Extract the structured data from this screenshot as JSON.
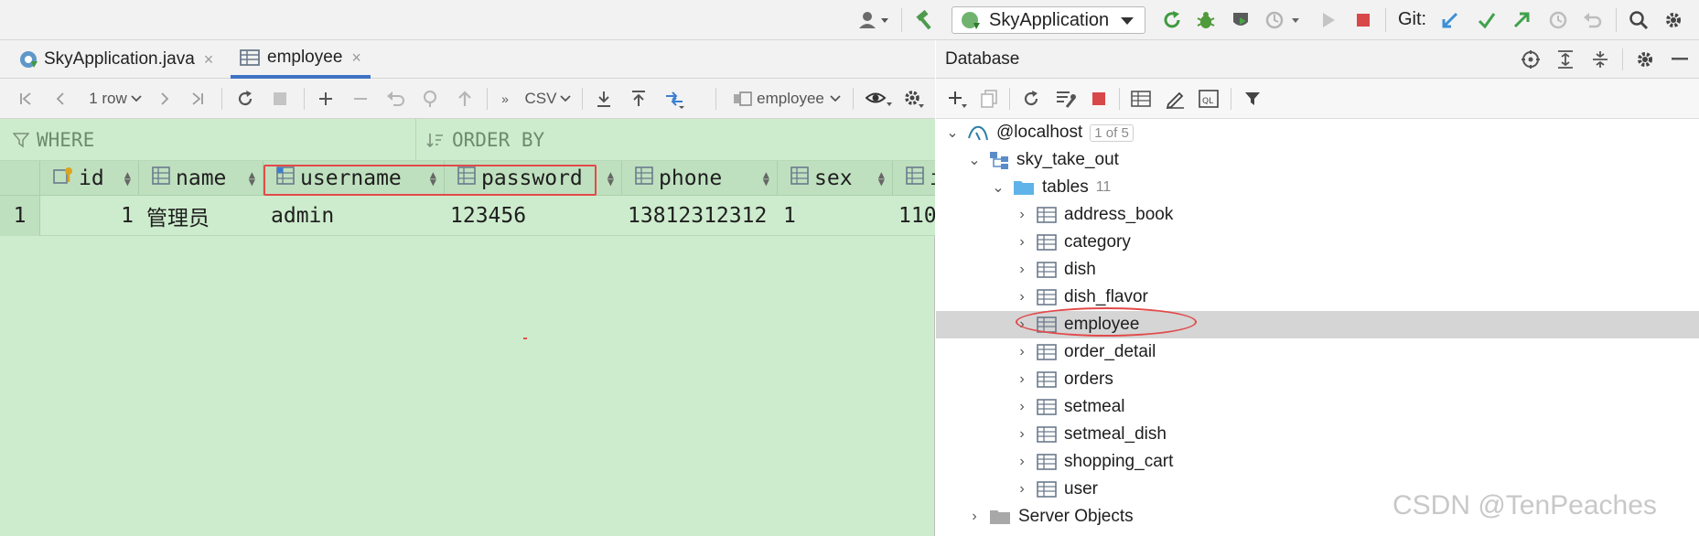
{
  "topbar": {
    "run_config_label": "SkyApplication",
    "git_label": "Git:",
    "icons": [
      "user-icon",
      "hammer-icon",
      "run-icon",
      "debug-icon",
      "coverage-icon",
      "profile-icon",
      "stop-icon",
      "git-update-icon",
      "git-commit-icon",
      "git-push-icon",
      "git-history-icon",
      "git-rollback-icon",
      "search-icon",
      "settings-icon"
    ]
  },
  "editor": {
    "tabs": [
      {
        "label": "SkyApplication.java",
        "active": false
      },
      {
        "label": "employee",
        "active": true
      }
    ],
    "toolbar": {
      "row_count": "1 row",
      "export_format": "CSV",
      "table_selector": "employee"
    },
    "filter": {
      "where_label": "WHERE",
      "order_by_label": "ORDER BY"
    },
    "columns": [
      "id",
      "name",
      "username",
      "password",
      "phone",
      "sex",
      "i"
    ],
    "rows": [
      {
        "row_number": "1",
        "id": "1",
        "name": "管理员",
        "username": "admin",
        "password": "123456",
        "phone": "13812312312",
        "sex": "1",
        "extra": "110"
      }
    ]
  },
  "database": {
    "title": "Database",
    "host": {
      "label": "@localhost",
      "badge": "1 of 5"
    },
    "schema": "sky_take_out",
    "tables_folder": {
      "label": "tables",
      "count": "11"
    },
    "tables": [
      "address_book",
      "category",
      "dish",
      "dish_flavor",
      "employee",
      "order_detail",
      "orders",
      "setmeal",
      "setmeal_dish",
      "shopping_cart",
      "user"
    ],
    "selected_table": "employee",
    "server_objects": "Server Objects"
  },
  "watermark": "CSDN @TenPeaches",
  "colors": {
    "grid_bg": "#cdeccd",
    "header_bg": "#bfe0bf",
    "highlight": "#e24a4a",
    "tab_accent": "#3f73c4",
    "selection": "#d5d5d5"
  }
}
